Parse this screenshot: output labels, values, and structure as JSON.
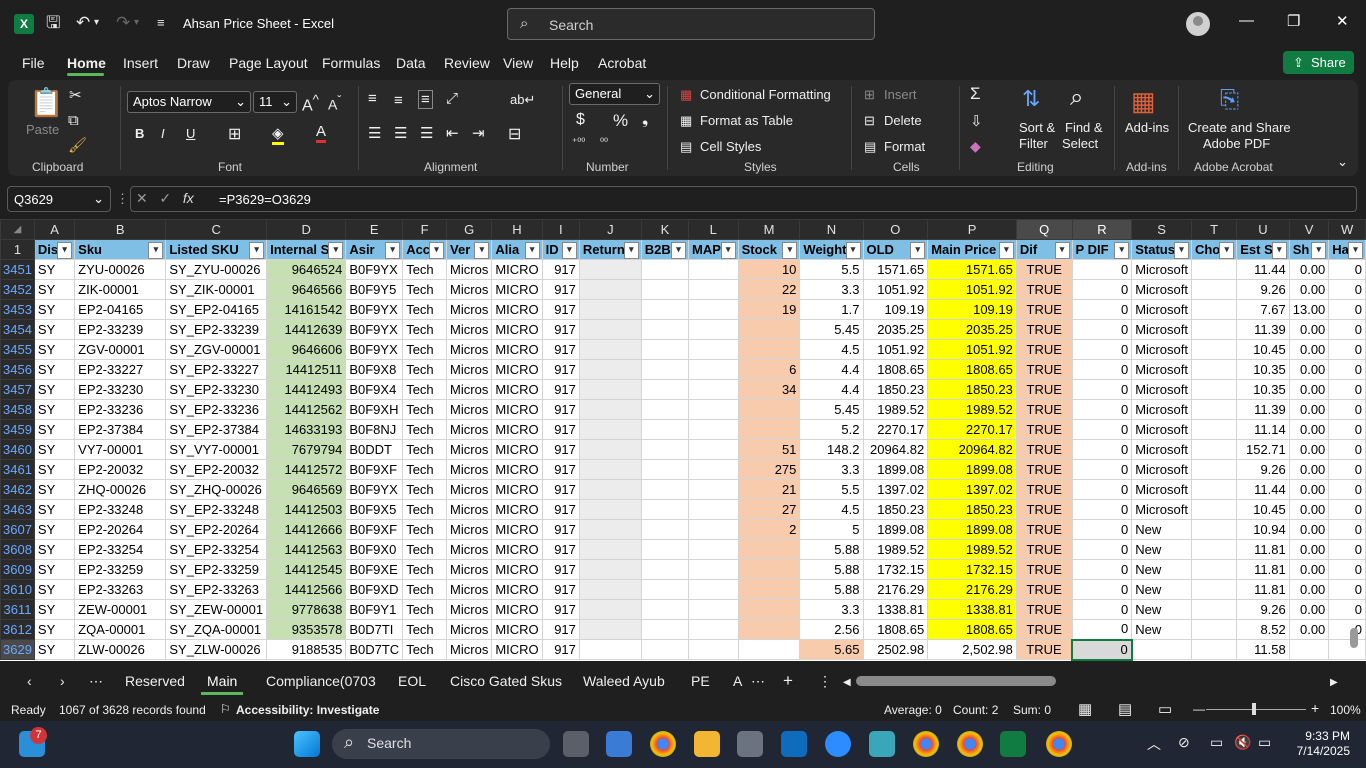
{
  "window": {
    "title": "Ahsan Price Sheet  -  Excel",
    "app_letter": "X"
  },
  "search": {
    "placeholder": "Search"
  },
  "menu": [
    "File",
    "Home",
    "Insert",
    "Draw",
    "Page Layout",
    "Formulas",
    "Data",
    "Review",
    "View",
    "Help",
    "Acrobat"
  ],
  "share_label": "Share",
  "ribbon": {
    "paste": "Paste",
    "font_name": "Aptos Narrow",
    "font_size": "11",
    "number_format": "General",
    "conditional_formatting": "Conditional Formatting",
    "format_as_table": "Format as Table",
    "cell_styles": "Cell Styles",
    "insert": "Insert",
    "delete": "Delete",
    "format": "Format",
    "sort_filter": "Sort &",
    "sort_filter2": "Filter",
    "find_select": "Find &",
    "find_select2": "Select",
    "addins": "Add-ins",
    "create_pdf": "Create and Share",
    "create_pdf2": "Adobe PDF",
    "groups": {
      "clipboard": "Clipboard",
      "font": "Font",
      "alignment": "Alignment",
      "number": "Number",
      "styles": "Styles",
      "cells": "Cells",
      "editing": "Editing",
      "addins": "Add-ins",
      "acrobat": "Adobe Acrobat"
    }
  },
  "formula_bar": {
    "name_box": "Q3629",
    "formula": "=P3629=O3629"
  },
  "columns": [
    "A",
    "B",
    "C",
    "D",
    "E",
    "F",
    "G",
    "H",
    "I",
    "J",
    "K",
    "L",
    "M",
    "N",
    "O",
    "P",
    "Q",
    "R",
    "S",
    "T",
    "U",
    "V",
    "W"
  ],
  "header_row": {
    "row": "1",
    "cells": [
      "Dis",
      "Sku",
      "Listed SKU",
      "Internal S",
      "Asir",
      "Acc",
      "Ver",
      "Alia",
      "ID",
      "Return",
      "B2B",
      "MAP",
      "Stock",
      "Weight",
      "OLD",
      "Main Price",
      "Dif",
      "P DIF",
      "Status",
      "Cho",
      "Est S",
      "Sh",
      "Ha"
    ]
  },
  "rows": [
    {
      "r": "3451",
      "cells": [
        "SY",
        "ZYU-00026",
        "SY_ZYU-00026",
        "9646524",
        "B0F9YX",
        "Tech",
        "Micros",
        "MICRO",
        "917",
        "",
        "",
        "",
        "10",
        "5.5",
        "1571.65",
        "1571.65",
        "TRUE",
        "0",
        "Microsoft",
        "",
        "11.44",
        "0.00",
        "0"
      ]
    },
    {
      "r": "3452",
      "cells": [
        "SY",
        "ZIK-00001",
        "SY_ZIK-00001",
        "9646566",
        "B0F9Y5",
        "Tech",
        "Micros",
        "MICRO",
        "917",
        "",
        "",
        "",
        "22",
        "3.3",
        "1051.92",
        "1051.92",
        "TRUE",
        "0",
        "Microsoft",
        "",
        "9.26",
        "0.00",
        "0"
      ]
    },
    {
      "r": "3453",
      "cells": [
        "SY",
        "EP2-04165",
        "SY_EP2-04165",
        "14161542",
        "B0F9YX",
        "Tech",
        "Micros",
        "MICRO",
        "917",
        "",
        "",
        "",
        "19",
        "1.7",
        "109.19",
        "109.19",
        "TRUE",
        "0",
        "Microsoft",
        "",
        "7.67",
        "13.00",
        "0"
      ]
    },
    {
      "r": "3454",
      "cells": [
        "SY",
        "EP2-33239",
        "SY_EP2-33239",
        "14412639",
        "B0F9YX",
        "Tech",
        "Micros",
        "MICRO",
        "917",
        "",
        "",
        "",
        "",
        "5.45",
        "2035.25",
        "2035.25",
        "TRUE",
        "0",
        "Microsoft",
        "",
        "11.39",
        "0.00",
        "0"
      ]
    },
    {
      "r": "3455",
      "cells": [
        "SY",
        "ZGV-00001",
        "SY_ZGV-00001",
        "9646606",
        "B0F9YX",
        "Tech",
        "Micros",
        "MICRO",
        "917",
        "",
        "",
        "",
        "",
        "4.5",
        "1051.92",
        "1051.92",
        "TRUE",
        "0",
        "Microsoft",
        "",
        "10.45",
        "0.00",
        "0"
      ]
    },
    {
      "r": "3456",
      "cells": [
        "SY",
        "EP2-33227",
        "SY_EP2-33227",
        "14412511",
        "B0F9X8",
        "Tech",
        "Micros",
        "MICRO",
        "917",
        "",
        "",
        "",
        "6",
        "4.4",
        "1808.65",
        "1808.65",
        "TRUE",
        "0",
        "Microsoft",
        "",
        "10.35",
        "0.00",
        "0"
      ]
    },
    {
      "r": "3457",
      "cells": [
        "SY",
        "EP2-33230",
        "SY_EP2-33230",
        "14412493",
        "B0F9X4",
        "Tech",
        "Micros",
        "MICRO",
        "917",
        "",
        "",
        "",
        "34",
        "4.4",
        "1850.23",
        "1850.23",
        "TRUE",
        "0",
        "Microsoft",
        "",
        "10.35",
        "0.00",
        "0"
      ]
    },
    {
      "r": "3458",
      "cells": [
        "SY",
        "EP2-33236",
        "SY_EP2-33236",
        "14412562",
        "B0F9XH",
        "Tech",
        "Micros",
        "MICRO",
        "917",
        "",
        "",
        "",
        "",
        "5.45",
        "1989.52",
        "1989.52",
        "TRUE",
        "0",
        "Microsoft",
        "",
        "11.39",
        "0.00",
        "0"
      ]
    },
    {
      "r": "3459",
      "cells": [
        "SY",
        "EP2-37384",
        "SY_EP2-37384",
        "14633193",
        "B0F8NJ",
        "Tech",
        "Micros",
        "MICRO",
        "917",
        "",
        "",
        "",
        "",
        "5.2",
        "2270.17",
        "2270.17",
        "TRUE",
        "0",
        "Microsoft",
        "",
        "11.14",
        "0.00",
        "0"
      ]
    },
    {
      "r": "3460",
      "cells": [
        "SY",
        "VY7-00001",
        "SY_VY7-00001",
        "7679794",
        "B0DDT",
        "Tech",
        "Micros",
        "MICRO",
        "917",
        "",
        "",
        "",
        "51",
        "148.2",
        "20964.82",
        "20964.82",
        "TRUE",
        "0",
        "Microsoft",
        "",
        "152.71",
        "0.00",
        "0"
      ]
    },
    {
      "r": "3461",
      "cells": [
        "SY",
        "EP2-20032",
        "SY_EP2-20032",
        "14412572",
        "B0F9XF",
        "Tech",
        "Micros",
        "MICRO",
        "917",
        "",
        "",
        "",
        "275",
        "3.3",
        "1899.08",
        "1899.08",
        "TRUE",
        "0",
        "Microsoft",
        "",
        "9.26",
        "0.00",
        "0"
      ]
    },
    {
      "r": "3462",
      "cells": [
        "SY",
        "ZHQ-00026",
        "SY_ZHQ-00026",
        "9646569",
        "B0F9YX",
        "Tech",
        "Micros",
        "MICRO",
        "917",
        "",
        "",
        "",
        "21",
        "5.5",
        "1397.02",
        "1397.02",
        "TRUE",
        "0",
        "Microsoft",
        "",
        "11.44",
        "0.00",
        "0"
      ]
    },
    {
      "r": "3463",
      "cells": [
        "SY",
        "EP2-33248",
        "SY_EP2-33248",
        "14412503",
        "B0F9X5",
        "Tech",
        "Micros",
        "MICRO",
        "917",
        "",
        "",
        "",
        "27",
        "4.5",
        "1850.23",
        "1850.23",
        "TRUE",
        "0",
        "Microsoft",
        "",
        "10.45",
        "0.00",
        "0"
      ]
    },
    {
      "r": "3607",
      "cells": [
        "SY",
        "EP2-20264",
        "SY_EP2-20264",
        "14412666",
        "B0F9XF",
        "Tech",
        "Micros",
        "MICRO",
        "917",
        "",
        "",
        "",
        "2",
        "5",
        "1899.08",
        "1899.08",
        "TRUE",
        "0",
        "New",
        "",
        "10.94",
        "0.00",
        "0"
      ]
    },
    {
      "r": "3608",
      "cells": [
        "SY",
        "EP2-33254",
        "SY_EP2-33254",
        "14412563",
        "B0F9X0",
        "Tech",
        "Micros",
        "MICRO",
        "917",
        "",
        "",
        "",
        "",
        "5.88",
        "1989.52",
        "1989.52",
        "TRUE",
        "0",
        "New",
        "",
        "11.81",
        "0.00",
        "0"
      ]
    },
    {
      "r": "3609",
      "cells": [
        "SY",
        "EP2-33259",
        "SY_EP2-33259",
        "14412545",
        "B0F9XE",
        "Tech",
        "Micros",
        "MICRO",
        "917",
        "",
        "",
        "",
        "",
        "5.88",
        "1732.15",
        "1732.15",
        "TRUE",
        "0",
        "New",
        "",
        "11.81",
        "0.00",
        "0"
      ]
    },
    {
      "r": "3610",
      "cells": [
        "SY",
        "EP2-33263",
        "SY_EP2-33263",
        "14412566",
        "B0F9XD",
        "Tech",
        "Micros",
        "MICRO",
        "917",
        "",
        "",
        "",
        "",
        "5.88",
        "2176.29",
        "2176.29",
        "TRUE",
        "0",
        "New",
        "",
        "11.81",
        "0.00",
        "0"
      ]
    },
    {
      "r": "3611",
      "cells": [
        "SY",
        "ZEW-00001",
        "SY_ZEW-00001",
        "9778638",
        "B0F9Y1",
        "Tech",
        "Micros",
        "MICRO",
        "917",
        "",
        "",
        "",
        "",
        "3.3",
        "1338.81",
        "1338.81",
        "TRUE",
        "0",
        "New",
        "",
        "9.26",
        "0.00",
        "0"
      ]
    },
    {
      "r": "3612",
      "cells": [
        "SY",
        "ZQA-00001",
        "SY_ZQA-00001",
        "9353578",
        "B0D7TI",
        "Tech",
        "Micros",
        "MICRO",
        "917",
        "",
        "",
        "",
        "",
        "2.56",
        "1808.65",
        "1808.65",
        "TRUE",
        "0",
        "New",
        "",
        "8.52",
        "0.00",
        "0"
      ]
    },
    {
      "r": "3629",
      "cells": [
        "SY",
        "ZLW-00026",
        "SY_ZLW-00026",
        "9188535",
        "B0D7TC",
        "Tech",
        "Micros",
        "MICRO",
        "917",
        "",
        "",
        "",
        "",
        "5.65",
        "2502.98",
        "2,502.98",
        "TRUE",
        "0",
        "",
        "",
        "11.58",
        "",
        ""
      ]
    }
  ],
  "sheet_tabs": [
    "Reserved",
    "Main",
    "Compliance(0703",
    "EOL",
    "Cisco Gated Skus",
    "Waleed Ayub",
    "PE",
    "A"
  ],
  "active_tab": "Main",
  "status": {
    "ready": "Ready",
    "records": "1067 of 3628 records found",
    "accessibility": "Accessibility: Investigate",
    "average": "Average: 0",
    "count": "Count: 2",
    "sum": "Sum: 0",
    "zoom": "100%"
  },
  "taskbar": {
    "search": "Search",
    "time": "9:33 PM",
    "date": "7/14/2025",
    "badge": "7"
  },
  "colors": {
    "excel_green": "#107c41",
    "header_blue": "#7fbfe6",
    "price_yellow": "#ffff00",
    "stock_salmon": "#f8cbad",
    "internal_green": "#c6e0b4"
  }
}
